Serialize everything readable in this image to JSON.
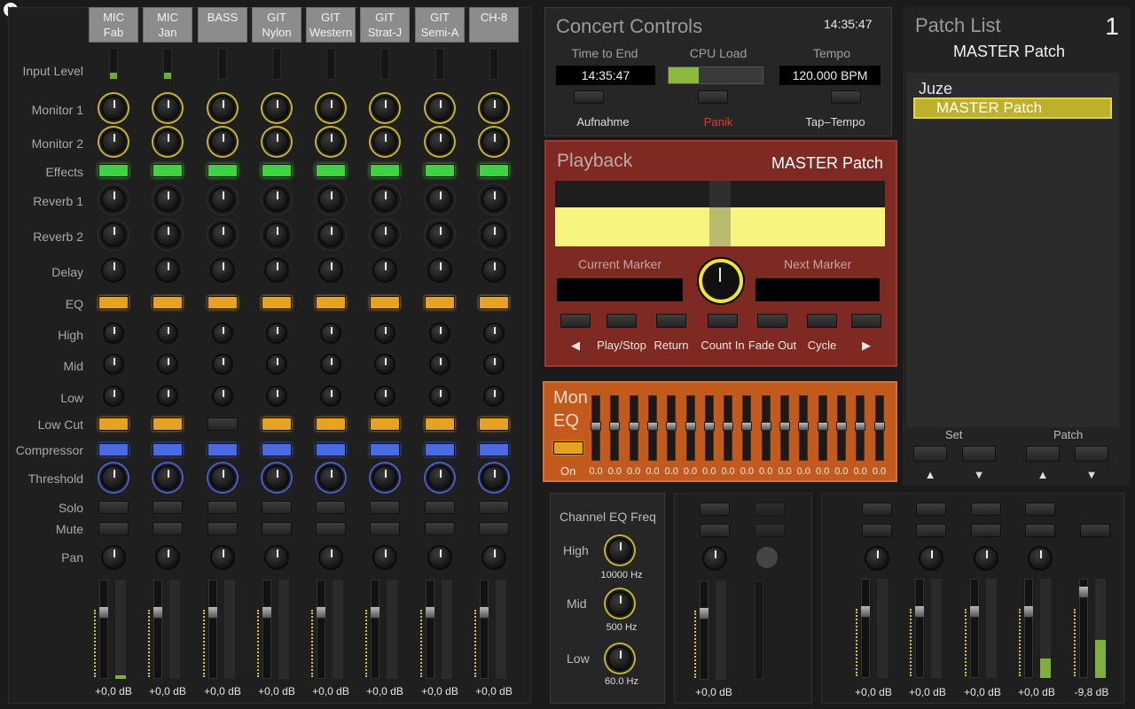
{
  "window": {
    "close_icon": "close-icon"
  },
  "mixer": {
    "channels": [
      {
        "l1": "MIC",
        "l2": "Fab",
        "db": "+0,0 dB",
        "input_level": 0.35
      },
      {
        "l1": "MIC",
        "l2": "Jan",
        "db": "+0,0 dB",
        "input_level": 0.35
      },
      {
        "l1": "BASS",
        "l2": "",
        "db": "+0,0 dB",
        "input_level": 0
      },
      {
        "l1": "GIT",
        "l2": "Nylon",
        "db": "+0,0 dB",
        "input_level": 0
      },
      {
        "l1": "GIT",
        "l2": "Western",
        "db": "+0,0 dB",
        "input_level": 0
      },
      {
        "l1": "GIT",
        "l2": "Strat-J",
        "db": "+0,0 dB",
        "input_level": 0
      },
      {
        "l1": "GIT",
        "l2": "Semi-A",
        "db": "+0,0 dB",
        "input_level": 0
      },
      {
        "l1": "CH-8",
        "l2": "",
        "db": "+0,0 dB",
        "input_level": 0
      }
    ],
    "rows": {
      "input_level": "Input Level",
      "monitor1": "Monitor 1",
      "monitor2": "Monitor 2",
      "effects": "Effects",
      "reverb1": "Reverb 1",
      "reverb2": "Reverb 2",
      "delay": "Delay",
      "eq": "EQ",
      "high": "High",
      "mid": "Mid",
      "low": "Low",
      "lowcut": "Low Cut",
      "compressor": "Compressor",
      "threshold": "Threshold",
      "solo": "Solo",
      "mute": "Mute",
      "pan": "Pan"
    },
    "lowcut_on": [
      true,
      true,
      false,
      true,
      true,
      true,
      true,
      true
    ]
  },
  "concert": {
    "title": "Concert Controls",
    "clock": "14:35:47",
    "time_to_end_label": "Time to End",
    "time_to_end": "14:35:47",
    "cpu_label": "CPU Load",
    "cpu_load": 0.32,
    "tempo_label": "Tempo",
    "tempo": "120.000 BPM",
    "rec_label": "Aufnahme",
    "panic_label": "Panik",
    "tap_label": "Tap–Tempo"
  },
  "playback": {
    "title": "Playback",
    "patch": "MASTER Patch",
    "current_marker": "Current Marker",
    "next_marker": "Next Marker",
    "buttons": [
      "◀",
      "Play/Stop",
      "Return",
      "Count In",
      "Fade Out",
      "Cycle",
      "▶"
    ]
  },
  "moneq": {
    "title1": "Mon",
    "title2": "EQ",
    "on_label": "On",
    "bands": [
      "0.0",
      "0.0",
      "0.0",
      "0.0",
      "0.0",
      "0.0",
      "0.0",
      "0.0",
      "0.0",
      "0.0",
      "0.0",
      "0.0",
      "0.0",
      "0.0",
      "0.0",
      "0.0"
    ]
  },
  "patchlist": {
    "title": "Patch List",
    "number": "1",
    "current": "MASTER Patch",
    "group": "Juze",
    "selected": "MASTER Patch",
    "set_label": "Set",
    "patch_label": "Patch",
    "up": "▲",
    "down": "▼"
  },
  "chaneq": {
    "title": "Channel EQ Freq",
    "high_label": "High",
    "high_val": "10000 Hz",
    "mid_label": "Mid",
    "mid_val": "500 Hz",
    "low_label": "Low",
    "low_val": "60.0 Hz"
  },
  "outputs": [
    {
      "db": "+0,0 dB",
      "level": 0
    },
    {
      "db": "+0,0 dB",
      "level": 0
    },
    {
      "db": "+0,0 dB",
      "level": 0
    },
    {
      "db": "+0,0 dB",
      "level": 0
    },
    {
      "db": "+0,0 dB",
      "level": 0.2
    },
    {
      "db": "-9,8 dB",
      "level": 0.38
    }
  ],
  "colors": {
    "accent_yellow": "#f5f57f",
    "playback_bg": "#7e2a22",
    "moneq_bg": "#c25a1e",
    "selected_patch": "#bdb02a"
  }
}
